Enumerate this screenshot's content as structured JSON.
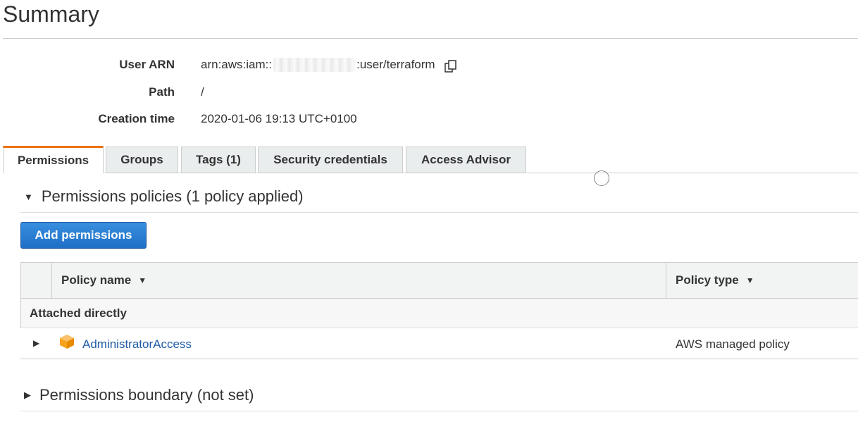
{
  "page": {
    "title": "Summary"
  },
  "summary": {
    "user_arn_label": "User ARN",
    "user_arn_prefix": "arn:aws:iam::",
    "user_arn_suffix": ":user/terraform",
    "path_label": "Path",
    "path_value": "/",
    "creation_label": "Creation time",
    "creation_value": "2020-01-06 19:13 UTC+0100"
  },
  "tabs": [
    {
      "label": "Permissions",
      "active": true
    },
    {
      "label": "Groups"
    },
    {
      "label": "Tags (1)"
    },
    {
      "label": "Security credentials"
    },
    {
      "label": "Access Advisor"
    }
  ],
  "permissions": {
    "policies_heading": "Permissions policies (1 policy applied)",
    "add_button": "Add permissions",
    "table": {
      "col_policy_name": "Policy name",
      "col_policy_type": "Policy type",
      "group_label": "Attached directly",
      "rows": [
        {
          "name": "AdministratorAccess",
          "type": "AWS managed policy"
        }
      ]
    },
    "boundary_heading": "Permissions boundary (not set)"
  },
  "colors": {
    "accent_tab": "#ec7211",
    "primary_button": "#1d6fc6",
    "link": "#1f5ca6",
    "cube": "#f7a21b"
  }
}
